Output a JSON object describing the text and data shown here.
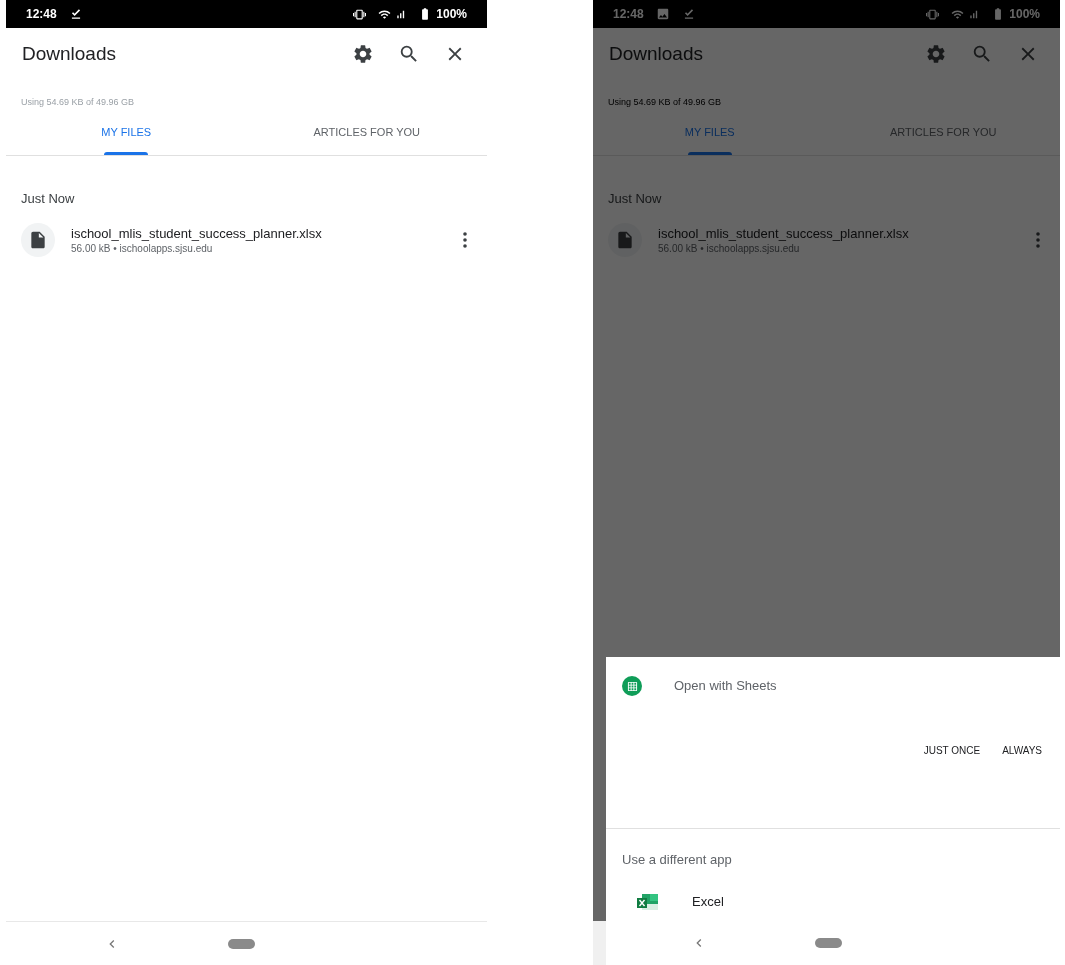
{
  "screens": [
    {
      "status_bar": {
        "time": "12:48",
        "notifications": [
          {
            "kind": "download"
          }
        ],
        "battery": "100%"
      },
      "app_bar": {
        "title": "Downloads"
      },
      "storage": "Using 54.69 KB of 49.96 GB",
      "tabs": [
        {
          "label": "MY FILES",
          "selected": true
        },
        {
          "label": "ARTICLES FOR YOU",
          "selected": false
        }
      ],
      "section": "Just Now",
      "files": [
        {
          "name": "ischool_mlis_student_success_planner.xlsx",
          "details": "56.00 kB • ischoolapps.sjsu.edu"
        }
      ]
    },
    {
      "status_bar": {
        "time": "12:48",
        "notifications": [
          {
            "kind": "image"
          },
          {
            "kind": "download"
          }
        ],
        "battery": "100%"
      },
      "app_bar": {
        "title": "Downloads"
      },
      "storage": "Using 54.69 KB of 49.96 GB",
      "tabs": [
        {
          "label": "MY FILES",
          "selected": true
        },
        {
          "label": "ARTICLES FOR YOU",
          "selected": false
        }
      ],
      "section": "Just Now",
      "files": [
        {
          "name": "ischool_mlis_student_success_planner.xlsx",
          "details": "56.00 kB • ischoolapps.sjsu.edu"
        }
      ],
      "dialog": {
        "title": "Open with Sheets",
        "buttons": [
          "JUST ONCE",
          "ALWAYS"
        ],
        "other_heading": "Use a different app",
        "apps": [
          {
            "name": "Excel"
          }
        ]
      }
    }
  ]
}
